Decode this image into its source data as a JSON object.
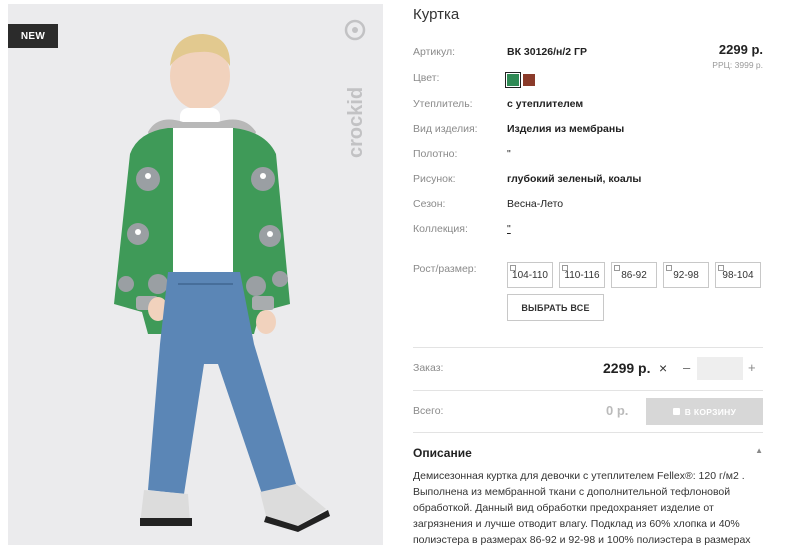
{
  "photo": {
    "badge": "NEW",
    "watermark": "crockid"
  },
  "product": {
    "title": "Куртка",
    "price": "2299 р.",
    "rrp": "РРЦ: 3999 р."
  },
  "attributes": [
    {
      "label": "Артикул:",
      "value": "ВК 30126/н/2 ГР"
    },
    {
      "label": "Цвет:",
      "value": ""
    },
    {
      "label": "Утеплитель:",
      "value": "с утеплителем"
    },
    {
      "label": "Вид изделия:",
      "value": "Изделия из мембраны"
    },
    {
      "label": "Полотно:",
      "value": "\""
    },
    {
      "label": "Рисунок:",
      "value": "глубокий зеленый, коалы"
    },
    {
      "label": "Сезон:",
      "value": "Весна-Лето"
    },
    {
      "label": "Коллекция:",
      "value": "\""
    }
  ],
  "colors": [
    "#2f8a55",
    "#8b3b2a"
  ],
  "size_label": "Рост/размер:",
  "sizes": [
    "104-110",
    "110-116",
    "86-92",
    "92-98",
    "98-104"
  ],
  "select_all": "ВЫБРАТЬ ВСЕ",
  "order": {
    "label": "Заказ:",
    "price": "2299 р.",
    "remove": "×",
    "minus": "–",
    "plus": "+"
  },
  "total": {
    "label": "Всего:",
    "value": "0 р.",
    "cart_button": "В КОРЗИНУ"
  },
  "description": {
    "title": "Описание",
    "text": "Демисезонная куртка для девочки с утеплителем Fellex®: 120 г/м2 . Выполнена из мембранной ткани с дополнительной тефлоновой обработкой. Данный вид обработки предохраняет изделие от загрязнения и лучше отводит влагу. Подклад из 60% хлопка и 40% полиэстера в размерах 86-92 и 92-98 и 100% полиэстера в размерах"
  }
}
